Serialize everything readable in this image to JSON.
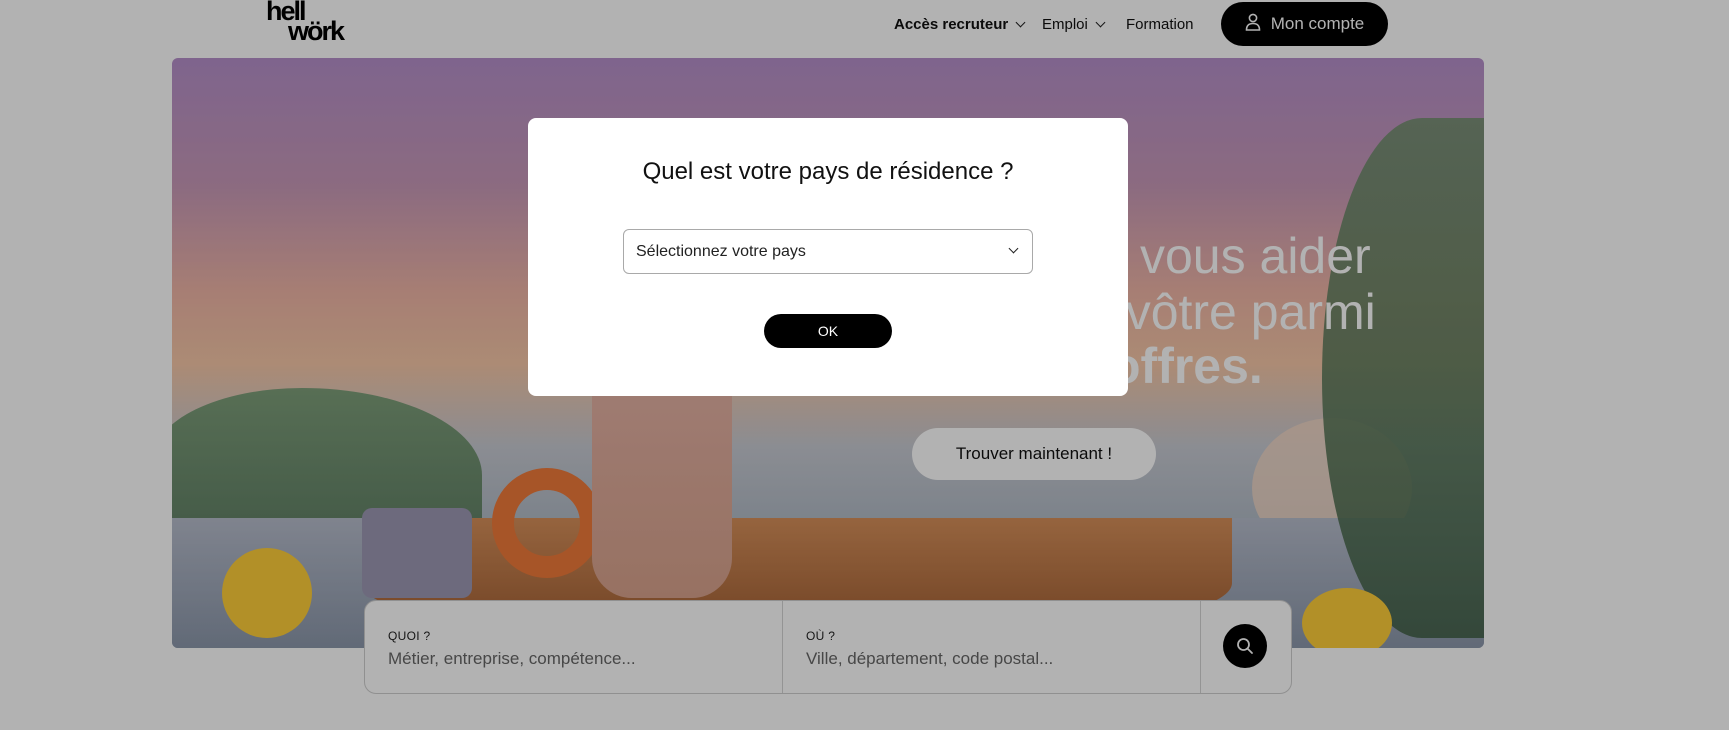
{
  "header": {
    "logo_line1": "hell",
    "logo_line2": "wörk",
    "nav": {
      "recruiter": "Accès recruteur",
      "emploi": "Emploi",
      "formation": "Formation"
    },
    "account_button": "Mon compte"
  },
  "hero": {
    "headline_line1": "vous aider",
    "headline_line2": "e vôtre parmi",
    "headline_line3": "offres.",
    "cta_button": "Trouver maintenant !"
  },
  "search": {
    "what_label": "QUOI ?",
    "what_placeholder": "Métier, entreprise, compétence...",
    "where_label": "OÙ ?",
    "where_placeholder": "Ville, département, code postal..."
  },
  "modal": {
    "title": "Quel est votre pays de résidence ?",
    "select_value": "Sélectionnez votre pays",
    "ok_button": "OK"
  },
  "colors": {
    "primary": "#000000",
    "overlay": "rgba(0,0,0,0.30)"
  }
}
